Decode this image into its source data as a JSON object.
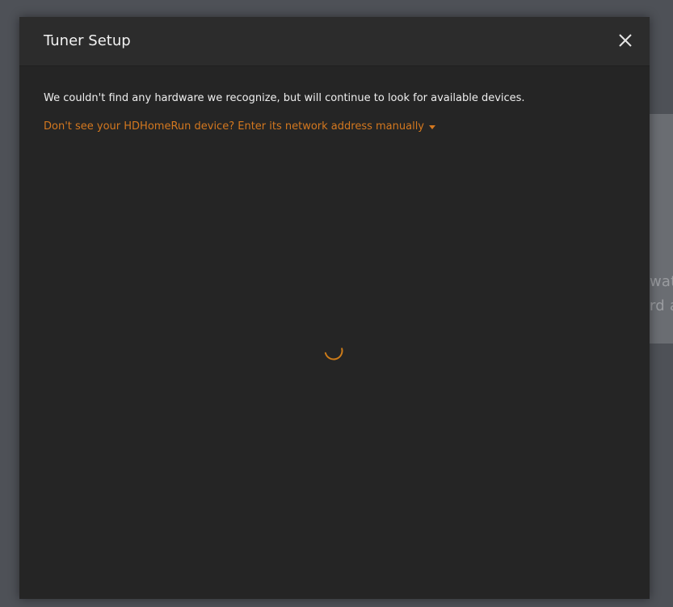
{
  "background": {
    "partial_text_line1": "watc",
    "partial_text_line2": "rd a"
  },
  "dialog": {
    "title": "Tuner Setup",
    "close_icon": "close-icon",
    "message": "We couldn't find any hardware we recognize, but will continue to look for available devices.",
    "manual_link": "Don't see your HDHomeRun device? Enter its network address manually",
    "caret_icon": "caret-down-icon",
    "loading_icon": "loading-spinner-icon"
  },
  "colors": {
    "accent": "#d4781f",
    "spinner": "#cc7b19",
    "dialog_bg": "#252525",
    "header_bg": "#2c2c2c",
    "page_bg": "#4e5157"
  }
}
